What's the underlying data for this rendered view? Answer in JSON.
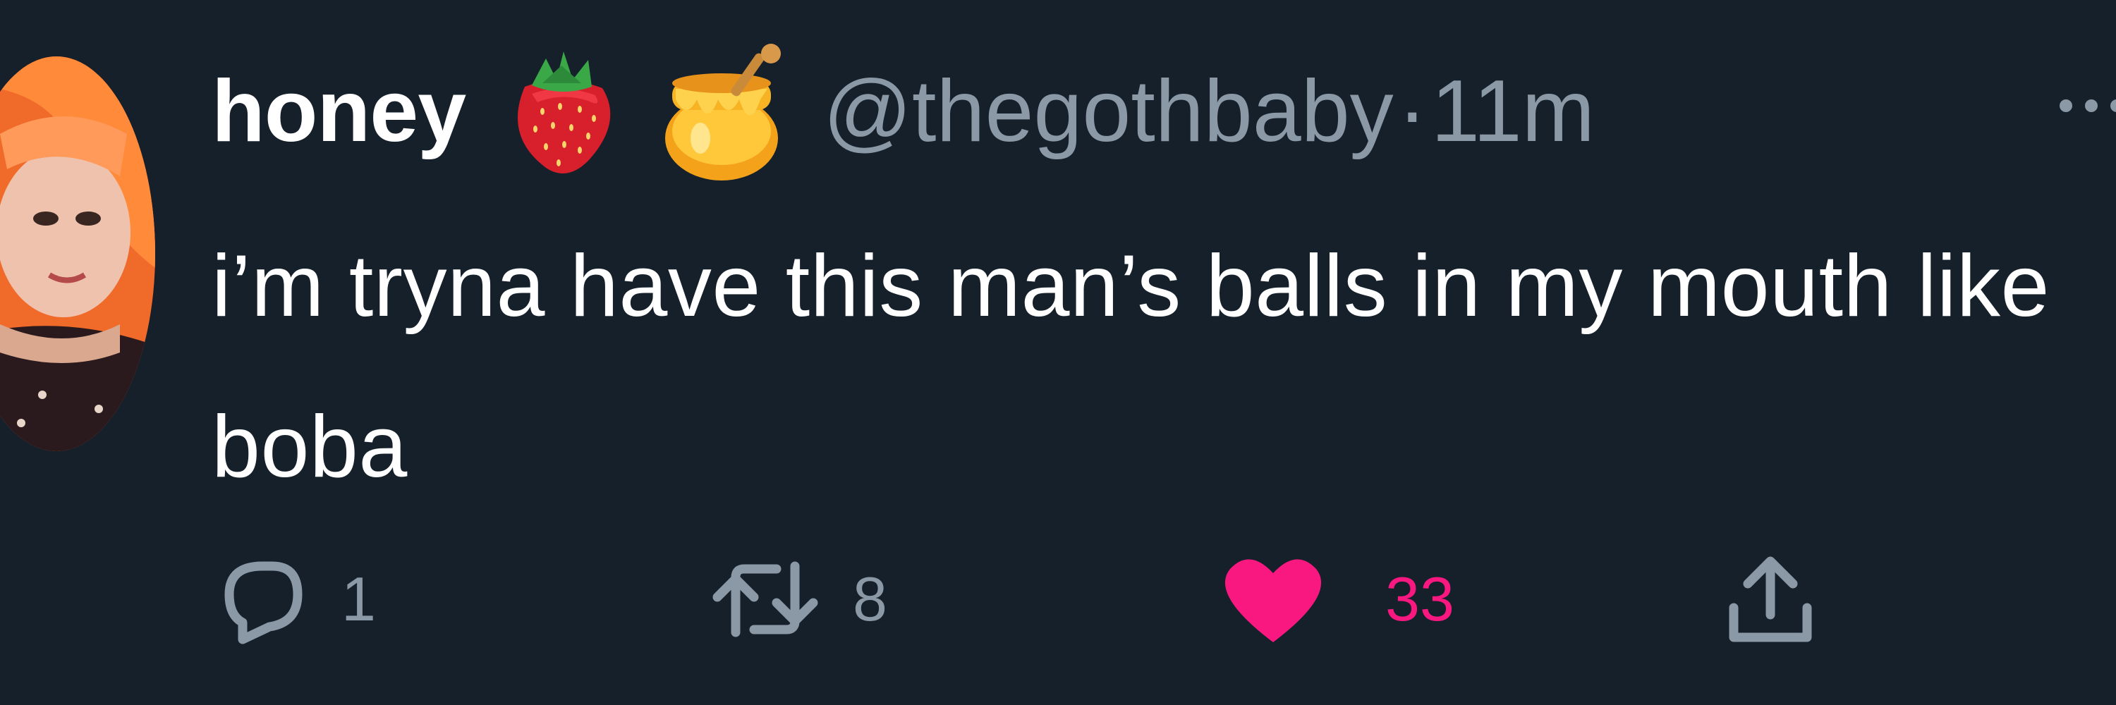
{
  "tweet": {
    "display_name": "honey",
    "name_emojis": [
      "strawberry-emoji",
      "honey-pot-emoji"
    ],
    "handle": "@thegothbaby",
    "separator": "·",
    "time": "11m",
    "text": "i’m tryna have this man’s balls in my mouth like boba"
  },
  "actions": {
    "reply_count": "1",
    "retweet_count": "8",
    "like_count": "33",
    "liked": true
  },
  "colors": {
    "background": "#15202b",
    "primary_text": "#ffffff",
    "secondary_text": "#8b98a5",
    "like_pink": "#f91880"
  },
  "icons": {
    "reply": "speech-bubble-icon",
    "retweet": "retweet-arrows-icon",
    "like": "heart-icon",
    "share": "share-upload-icon",
    "more": "more-dots-icon"
  }
}
